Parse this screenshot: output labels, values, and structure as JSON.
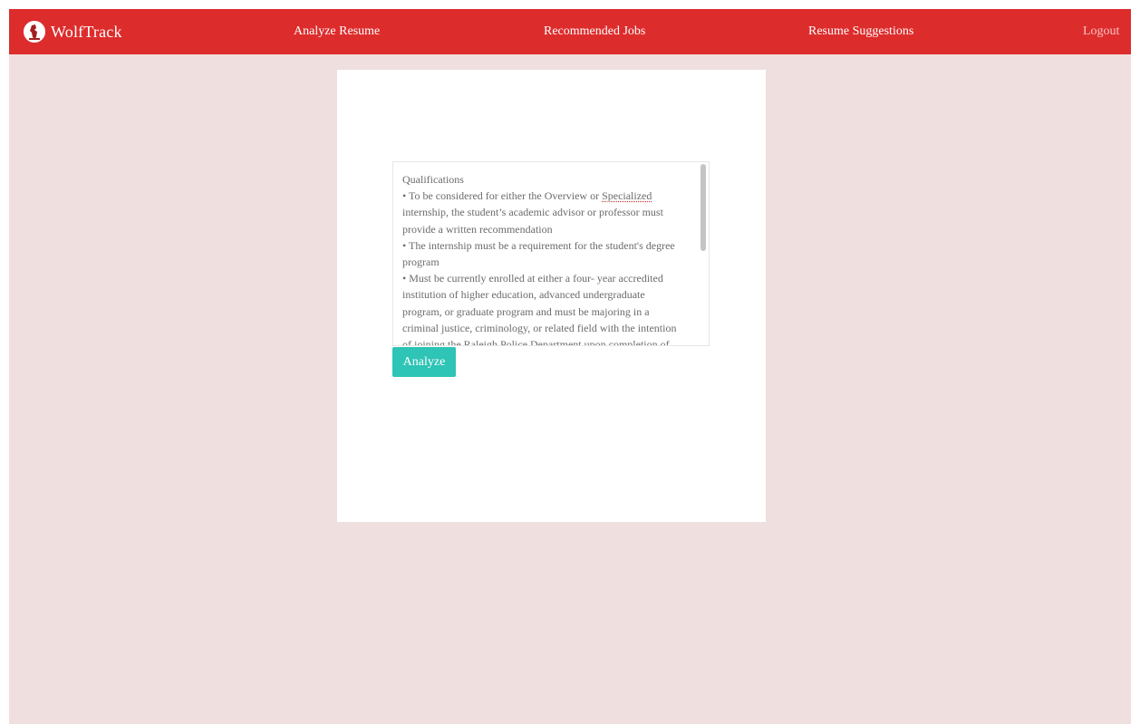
{
  "navbar": {
    "brand": "WolfTrack",
    "links": {
      "analyze_resume": "Analyze Resume",
      "recommended_jobs": "Recommended Jobs",
      "resume_suggestions": "Resume Suggestions",
      "logout": "Logout"
    }
  },
  "analyzer": {
    "textarea_lines": [
      "Qualifications",
      "• To be considered for either the Overview or Specialized",
      "internship, the student’s academic advisor or professor must",
      "provide a written recommendation",
      "• The internship must be a requirement for the student's degree",
      "program",
      "• Must be currently enrolled at either a four- year accredited",
      "institution of higher education, advanced undergraduate",
      "program, or graduate program and must be majoring in a",
      "criminal justice, criminology, or related field with the intention",
      "of joining the Raleigh Police Department upon completion of"
    ],
    "spellcheck_word": "Specialized",
    "analyze_button": "Analyze"
  },
  "colors": {
    "navbar": "#dd2c2c",
    "background": "#f0dfdf",
    "button": "#2ec4b6"
  },
  "icons": {
    "brand_logo": "wolf-logo-icon"
  }
}
